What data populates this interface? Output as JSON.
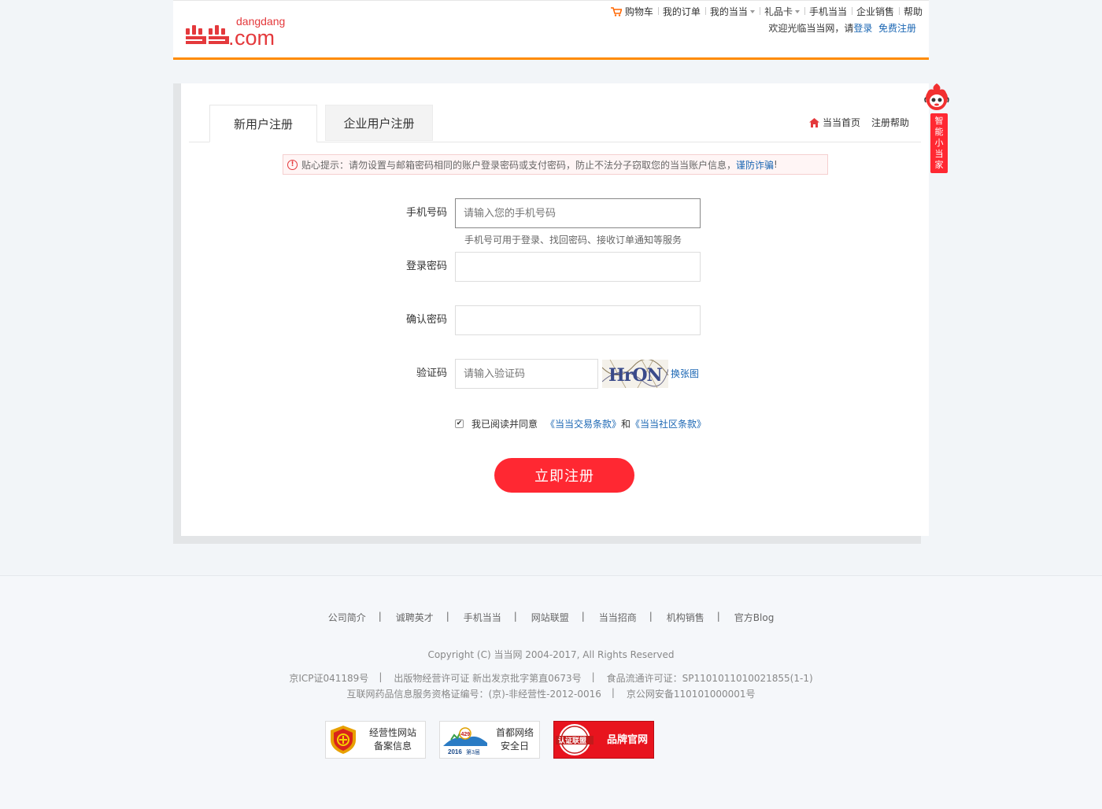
{
  "header": {
    "logo_brand": "dangdang",
    "logo_domain": "com",
    "nav": [
      {
        "label": "购物车"
      },
      {
        "label": "我的订单"
      },
      {
        "label": "我的当当"
      },
      {
        "label": "礼品卡"
      },
      {
        "label": "手机当当"
      },
      {
        "label": "企业销售"
      },
      {
        "label": "帮助"
      }
    ],
    "welcome_text": "欢迎光临当当网，请",
    "login_link": "登录",
    "register_link": "免费注册"
  },
  "tabs": {
    "personal": "新用户注册",
    "enterprise": "企业用户注册"
  },
  "panel_links": {
    "home": "当当首页",
    "help": "注册帮助"
  },
  "notice": {
    "text": "贴心提示：请勿设置与邮箱密码相同的账户登录密码或支付密码，防止不法分子窃取您的当当账户信息，",
    "link": "谨防诈骗",
    "suffix": "!"
  },
  "form": {
    "phone_label": "手机号码",
    "phone_placeholder": "请输入您的手机号码",
    "phone_hint": "手机号可用于登录、找回密码、接收订单通知等服务",
    "password_label": "登录密码",
    "confirm_label": "确认密码",
    "captcha_label": "验证码",
    "captcha_placeholder": "请输入验证码",
    "captcha_text": "HrON",
    "captcha_refresh": "换张图",
    "agree_text": "我已阅读并同意",
    "terms_trade": "《当当交易条款》",
    "and": "和",
    "terms_community": "《当当社区条款》",
    "agree_checked": true,
    "submit": "立即注册"
  },
  "side_helper": {
    "label": [
      "智",
      "能",
      "小",
      "当",
      "家"
    ]
  },
  "footer": {
    "links": [
      "公司简介",
      "诚聘英才",
      "手机当当",
      "网站联盟",
      "当当招商",
      "机构销售",
      "官方Blog"
    ],
    "copyright": "Copyright (C) 当当网 2004-2017, All Rights Reserved",
    "licenses_row1": [
      "京ICP证041189号",
      "出版物经营许可证 新出发京批字第直0673号",
      "食品流通许可证：SP1101011010021855(1-1)"
    ],
    "licenses_row2": [
      "互联网药品信息服务资格证编号：(京)-非经营性-2012-0016",
      "京公网安备110101000001号"
    ],
    "badges": [
      {
        "line1": "经营性网站",
        "line2": "备案信息"
      },
      {
        "line1": "首都网络",
        "line2": "安全日",
        "year": "2016",
        "edition": "第3届",
        "emblem": "429"
      },
      {
        "label": "品牌官网",
        "emblem": "认证联盟"
      }
    ]
  },
  "colors": {
    "brand_red": "#ff2832",
    "header_orange": "#ff8b00",
    "link_blue": "#1a66b3"
  }
}
